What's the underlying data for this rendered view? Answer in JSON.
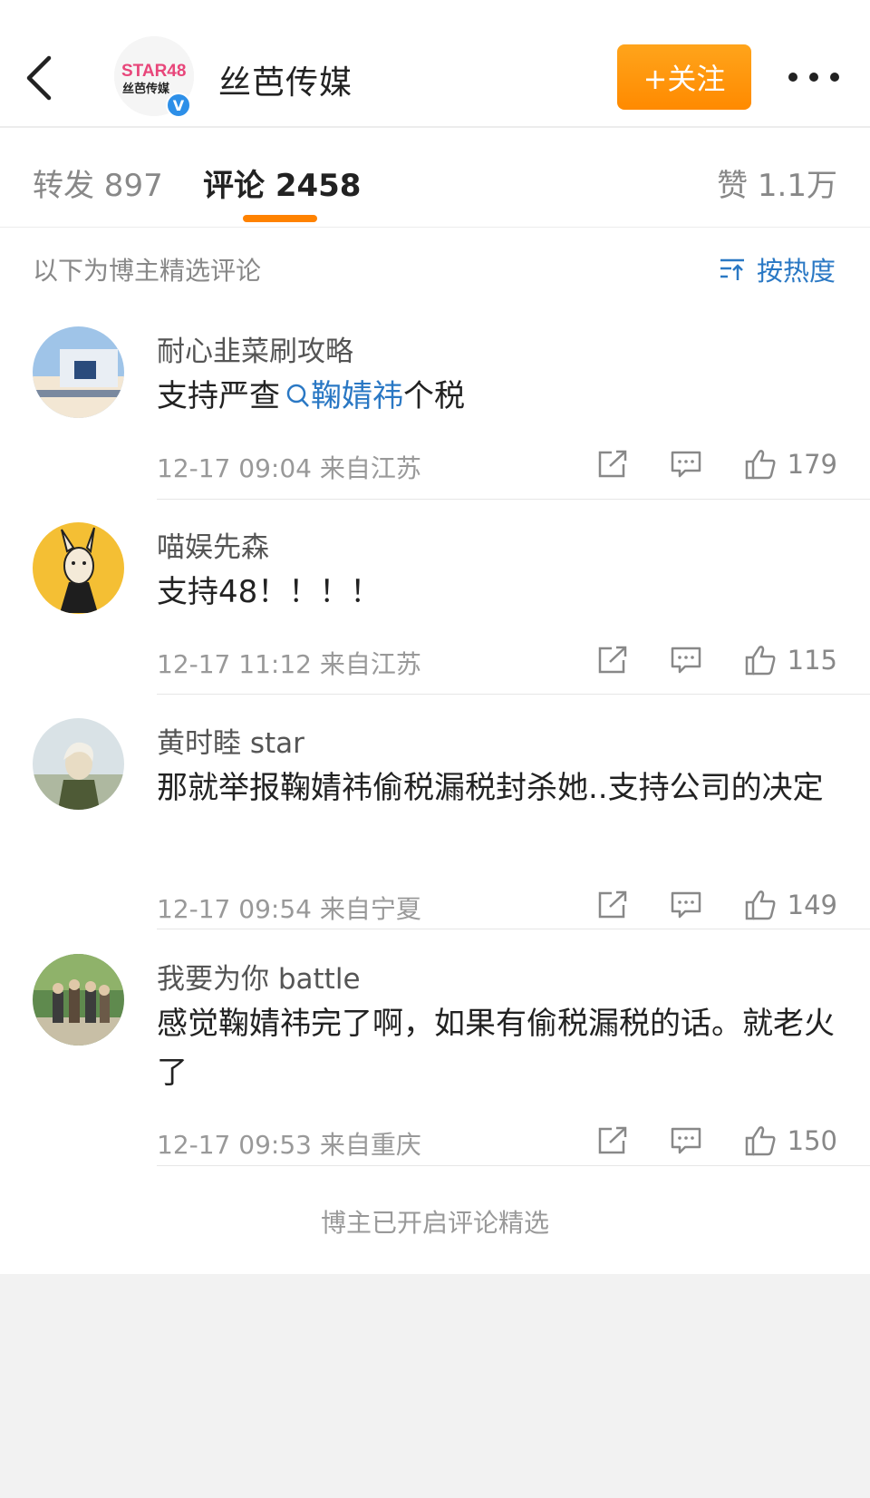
{
  "header": {
    "account_name": "丝芭传媒",
    "logo_text_top": "STAR48",
    "logo_text_bottom": "丝芭传媒",
    "verified_mark": "V",
    "follow_label": "+关注",
    "colors": {
      "follow_bg": "#ff8a00",
      "verified": "#2d8fe8"
    }
  },
  "tabs": {
    "repost": "转发 897",
    "comments": "评论 2458",
    "likes": "赞 1.1万",
    "active": "comments",
    "accent": "#ff8200"
  },
  "filter": {
    "label": "以下为博主精选评论",
    "sort_label": "按热度",
    "link_color": "#2a78c4"
  },
  "comments": [
    {
      "user": "耐心韭菜刷攻略",
      "text_before": "支持严查",
      "link_text": "鞠婧祎",
      "text_after": "个税",
      "meta": "12-17 09:04  来自江苏",
      "likes": "179"
    },
    {
      "user": "喵娱先森",
      "text": "支持48！！！！",
      "meta": "12-17 11:12  来自江苏",
      "likes": "115"
    },
    {
      "user": "黄时睦 star",
      "text": "那就举报鞠婧祎偷税漏税封杀她..支持公司的决定",
      "meta": "12-17 09:54  来自宁夏",
      "likes": "149"
    },
    {
      "user": "我要为你 battle",
      "text": "感觉鞠婧祎完了啊，如果有偷税漏税的话。就老火了",
      "meta": "12-17 09:53  来自重庆",
      "likes": "150"
    }
  ],
  "footer": {
    "note": "博主已开启评论精选"
  }
}
